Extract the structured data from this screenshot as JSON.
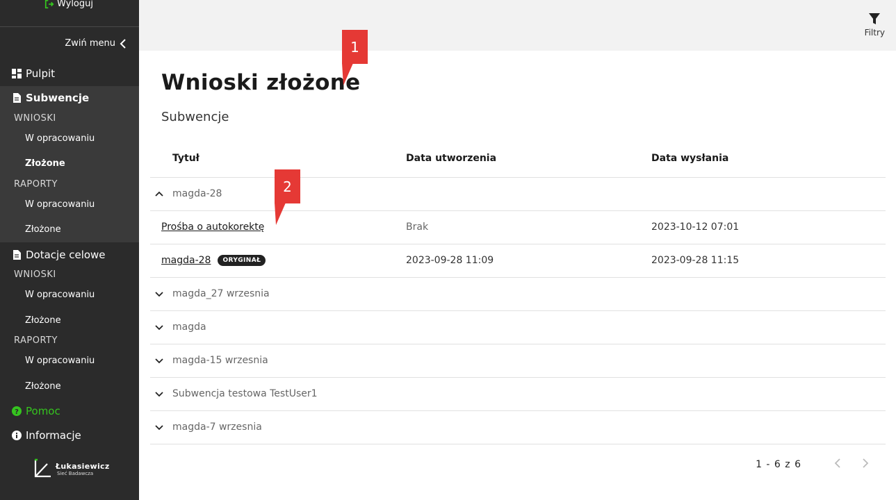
{
  "sidebar": {
    "logout_label": "Wyloguj",
    "collapse_label": "Zwiń menu",
    "items": {
      "pulpit": "Pulpit",
      "subwencje": "Subwencje",
      "wnioski_1": "WNIOSKI",
      "w_opracowaniu_1": "W opracowaniu",
      "zlozone_1": "Złożone",
      "raporty_1": "RAPORTY",
      "w_opracowaniu_2": "W opracowaniu",
      "zlozone_2": "Złożone",
      "dotacje": "Dotacje celowe",
      "wnioski_2": "WNIOSKI",
      "w_opracowaniu_3": "W opracowaniu",
      "zlozone_3": "Złożone",
      "raporty_2": "RAPORTY",
      "w_opracowaniu_4": "W opracowaniu",
      "zlozone_4": "Złożone",
      "pomoc": "Pomoc",
      "informacje": "Informacje"
    },
    "logo": {
      "name": "Łukasiewicz",
      "sub": "Sieć Badawcza"
    }
  },
  "topbar": {
    "filter_label": "Filtry"
  },
  "page": {
    "title": "Wnioski złożone",
    "subtitle": "Subwencje"
  },
  "table": {
    "headers": {
      "title": "Tytuł",
      "created": "Data utworzenia",
      "sent": "Data wysłania"
    },
    "groups": [
      "magda-28",
      "magda_27 wrzesnia",
      "magda",
      "magda-15 wrzesnia",
      "Subwencja testowa TestUser1",
      "magda-7 wrzesnia"
    ],
    "rows": [
      {
        "title": "Prośba o autokorektę",
        "created": "Brak",
        "sent": "2023-10-12 07:01"
      },
      {
        "title": "magda-28",
        "badge": "ORYGINAŁ",
        "created": "2023-09-28 11:09",
        "sent": "2023-09-28 11:15"
      }
    ]
  },
  "pagination": {
    "label": "1 - 6 z 6"
  },
  "annotations": {
    "one": "1",
    "two": "2"
  },
  "colors": {
    "accent_green": "#35c41f",
    "sidebar_bg": "#2b2b2b",
    "callout_red": "#e53935"
  }
}
